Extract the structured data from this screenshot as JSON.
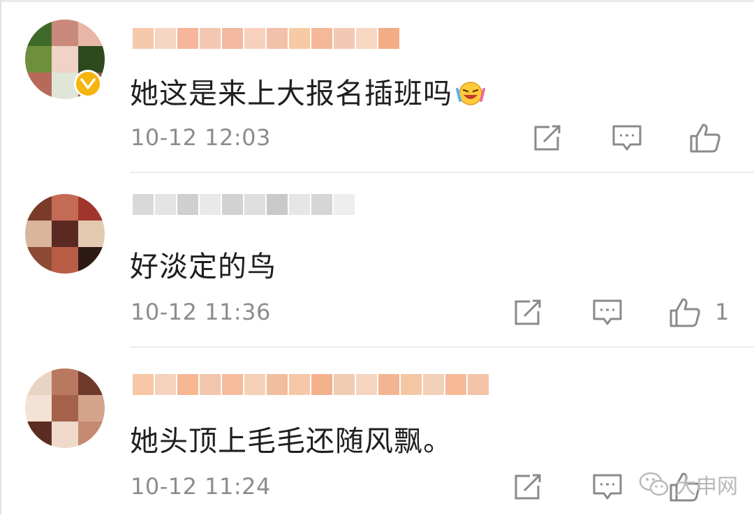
{
  "comments": [
    {
      "text": "她这是来上大报名插班吗",
      "emoji": "laugh-cry-emoji",
      "time": "10-12 12:03",
      "likes": "",
      "verified": true,
      "avatar_colors": [
        "#3f6b2a",
        "#c98a7b",
        "#e8b7a8",
        "#6e8f3d",
        "#f0d2c6",
        "#2d4a1e",
        "#b86a5a",
        "#dfe6d8",
        "#8a5a45"
      ],
      "username_blur_colors": [
        "#f6c9ad",
        "#f4d6c3",
        "#f7b59a",
        "#f4c7b1",
        "#f2b9a0",
        "#f6d1bd",
        "#f3c1a9",
        "#f7caa6",
        "#f5b898",
        "#f1c9b5",
        "#f7d7c2",
        "#f3ad86"
      ]
    },
    {
      "text": "好淡定的鸟",
      "emoji": "",
      "time": "10-12 11:36",
      "likes": "1",
      "verified": false,
      "avatar_colors": [
        "#7a3b2a",
        "#c46a55",
        "#a0362b",
        "#d8b59b",
        "#5a2a22",
        "#e3c9b0",
        "#8c4a34",
        "#b85c46",
        "#2e1a15"
      ],
      "username_blur_colors": [
        "#d9d9d9",
        "#e4e4e4",
        "#cfcfcf",
        "#e9e9e9",
        "#d2d2d2",
        "#dedede",
        "#c9c9c9",
        "#e6e6e6",
        "#d6d6d6",
        "#eeeeee"
      ]
    },
    {
      "text": "她头顶上毛毛还随风飘。",
      "emoji": "",
      "time": "10-12 11:24",
      "likes": "",
      "verified": false,
      "avatar_colors": [
        "#e9d4c4",
        "#b97960",
        "#6f3a2a",
        "#f3e2d5",
        "#a5624a",
        "#d4a48c",
        "#5b2c20",
        "#efd9ca",
        "#c48b72"
      ],
      "username_blur_colors": [
        "#f7c7a6",
        "#f3d3bd",
        "#f6b793",
        "#f2c5ad",
        "#f5bb9b",
        "#f6d0b8",
        "#f1be9f",
        "#f7c8a8",
        "#f4b28c",
        "#f2cbb3",
        "#f6d5bf",
        "#f3b591",
        "#f5c6a4",
        "#f2d0b9",
        "#f6ba97",
        "#f3c3a7"
      ]
    }
  ],
  "watermark": {
    "text": "大申网",
    "icon": "wechat-icon"
  },
  "colors": {
    "verified_badge": "#f5b40e",
    "text": "#1f1f1f",
    "meta": "#8c8c8c",
    "icon": "#8a8a8a",
    "divider": "#ececec"
  }
}
